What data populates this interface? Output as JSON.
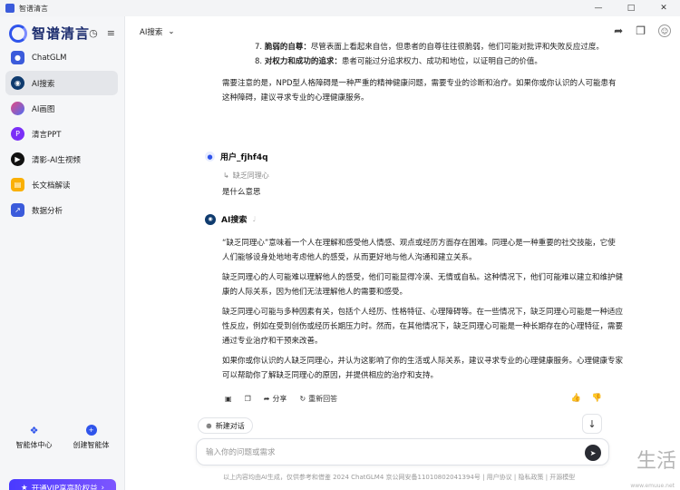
{
  "window": {
    "title": "智谱清言"
  },
  "sidebar": {
    "logo_text": "智谱清言",
    "items": [
      {
        "label": "ChatGLM",
        "icon": "chatglm-icon",
        "color": "#3b5bdb"
      },
      {
        "label": "AI搜索",
        "icon": "ai-search-icon",
        "color": "#0f3b6e"
      },
      {
        "label": "AI画图",
        "icon": "ai-paint-icon",
        "color": "#e64980"
      },
      {
        "label": "清言PPT",
        "icon": "ppt-icon",
        "color": "#7b2ff7"
      },
      {
        "label": "清影-AI生视频",
        "icon": "video-icon",
        "color": "#111111"
      },
      {
        "label": "长文档解读",
        "icon": "document-icon",
        "color": "#fab005"
      },
      {
        "label": "数据分析",
        "icon": "chart-icon",
        "color": "#3b5bdb"
      }
    ],
    "agent_center": "智能体中心",
    "create_agent": "创建智能体",
    "vip_label": "开通VIP享高阶权益"
  },
  "topbar": {
    "model": "AI搜索"
  },
  "list": [
    {
      "num": "7.",
      "title": "脆弱的自尊：",
      "text": "尽管表面上看起来自信，但患者的自尊往往很脆弱，他们可能对批评和失败反应过度。"
    },
    {
      "num": "8.",
      "title": "对权力和成功的追求：",
      "text": "患者可能过分追求权力、成功和地位，以证明自己的价值。"
    }
  ],
  "prev_summary": "需要注意的是，NPD型人格障碍是一种严重的精神健康问题，需要专业的诊断和治疗。如果你或你认识的人可能患有这种障碍，建议寻求专业的心理健康服务。",
  "user": {
    "name": "用户_fjhf4q",
    "quote": "缺乏同理心",
    "message": "是什么意思"
  },
  "ai": {
    "name": "AI搜索",
    "paragraphs": [
      "“缺乏同理心”意味着一个人在理解和感受他人情感、观点或经历方面存在困难。同理心是一种重要的社交技能，它使人们能够设身处地地考虑他人的感受，从而更好地与他人沟通和建立关系。",
      "缺乏同理心的人可能难以理解他人的感受，他们可能显得冷漠、无情或自私。这种情况下，他们可能难以建立和维护健康的人际关系，因为他们无法理解他人的需要和感受。",
      "缺乏同理心可能与多种因素有关，包括个人经历、性格特征、心理障碍等。在一些情况下，缺乏同理心可能是一种适应性反应，例如在受到创伤或经历长期压力时。然而，在其他情况下，缺乏同理心可能是一种长期存在的心理特征，需要通过专业治疗和干预来改善。",
      "如果你或你认识的人缺乏同理心，并认为这影响了你的生活或人际关系，建议寻求专业的心理健康服务。心理健康专家可以帮助你了解缺乏同理心的原因，并提供相应的治疗和支持。"
    ],
    "share": "分享",
    "regenerate": "重新回答"
  },
  "new_chat": "新建对话",
  "input": {
    "placeholder": "输入你的问题或需求"
  },
  "footer": "以上内容均由AI生成，仅供参考和借鉴   2024 ChatGLM4 京公网安备11010802041394号 | 用户协议 | 隐私政策 | 开源模型",
  "watermark": {
    "big": "生活",
    "small": "www.emuue.net"
  }
}
